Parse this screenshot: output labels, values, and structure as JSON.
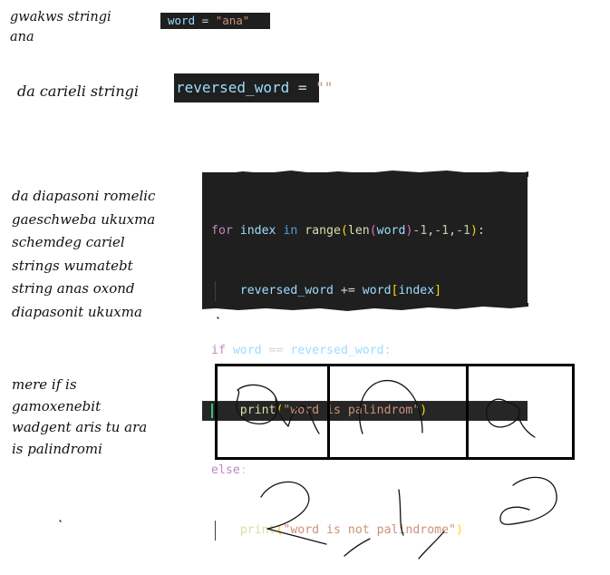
{
  "notes": {
    "string_note": [
      "gwakws stringi",
      "ana"
    ],
    "empty_string_note": [
      "da carieli stringi"
    ],
    "range_note": [
      "da diapasoni romelic",
      "gaeschweba ukuxma",
      "schemdeg cariel",
      "strings wumatebt",
      "string anas oxond",
      "diapasonit ukuxma"
    ],
    "if_note": [
      "mere if is",
      "gamoxenebit",
      "wadgent aris tu ara",
      "is palindromi"
    ]
  },
  "code": {
    "word_assign": {
      "var": "word",
      "op": " = ",
      "value": "\"ana\""
    },
    "reversed_assign": {
      "var": "reversed_word",
      "op": " = ",
      "value": "\"\""
    },
    "lines": {
      "l1": {
        "for": "for",
        "index": " index ",
        "in": "in",
        "range": " range",
        "p1": "(",
        "len": "len",
        "p2": "(",
        "word": "word",
        "p3": ")",
        "m1": "-1",
        "c1": ",",
        "m2": "-1",
        "c2": ",",
        "m3": "-1",
        "p4": ")",
        "colon": ":"
      },
      "l2": {
        "rev": "reversed_word",
        "op": " += ",
        "word": "word",
        "b1": "[",
        "idx": "index",
        "b2": "]"
      },
      "l3": {
        "if": "if",
        "word": " word ",
        "eq": "==",
        "rev": " reversed_word",
        "colon": ":"
      },
      "l4": {
        "print": "print",
        "p1": "(",
        "str": "\"word is palindrom\"",
        "p2": ")"
      },
      "l5": {
        "else": "else",
        "colon": ":"
      },
      "l6": {
        "print": "print",
        "p1": "(",
        "str": "\"word is not palindrome\"",
        "p2": ")"
      }
    }
  },
  "colors": {
    "editor_bg": "#1f1f1f",
    "keyword": "#c586c0",
    "builtin": "#dcdcaa",
    "variable": "#9cdcfe",
    "number": "#b5cea8",
    "string": "#ce9178",
    "cursor": "#36c36b"
  },
  "drawing": {
    "panels": 3,
    "content": "hand-drawn letters a, n, a in three boxes"
  }
}
